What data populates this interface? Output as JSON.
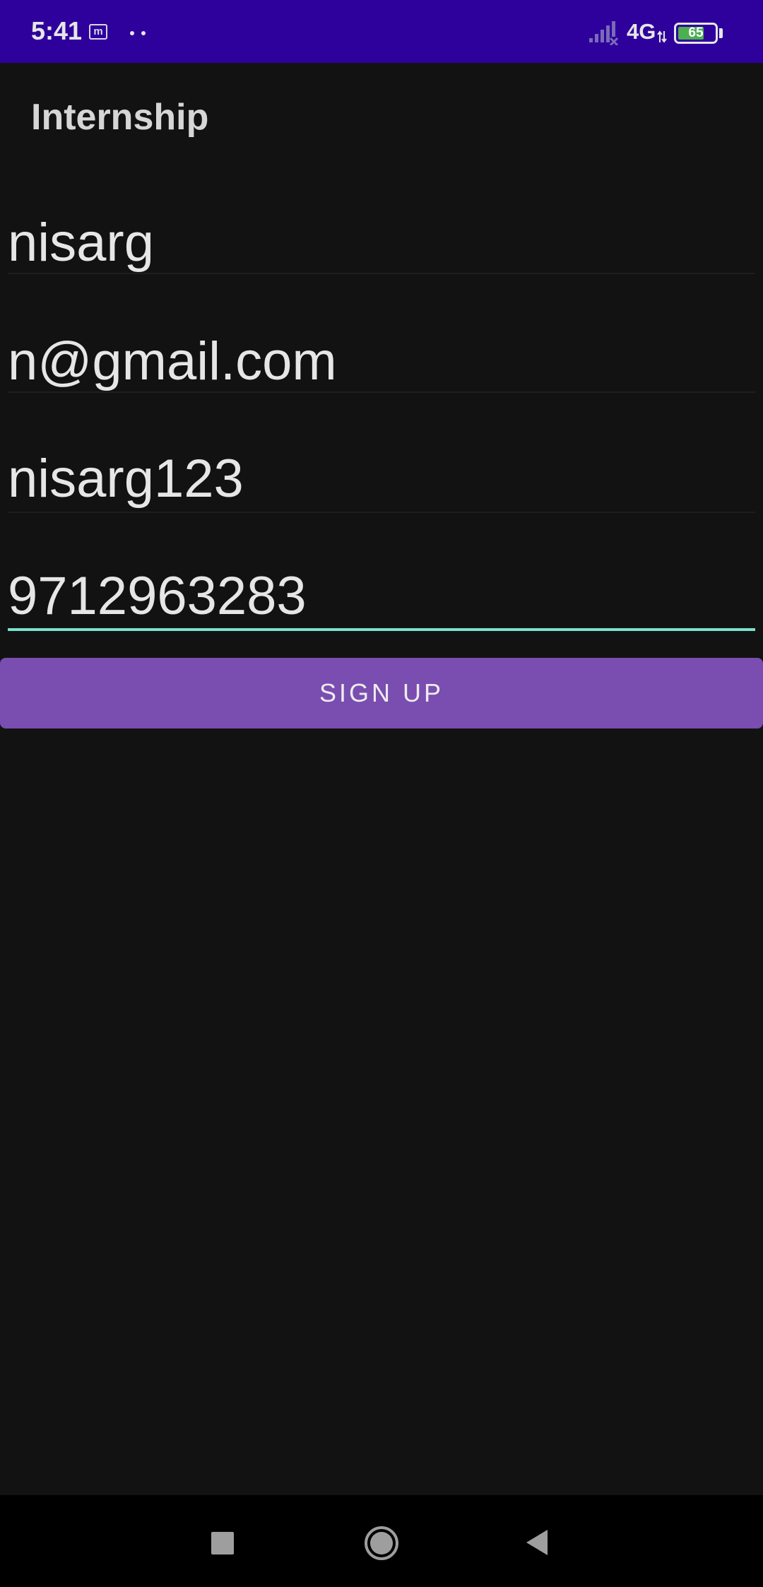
{
  "status_bar": {
    "time": "5:41",
    "notification_icon": "m",
    "network": "4G",
    "battery_level": "65",
    "battery_color": "#4caf50",
    "background": "#2e009c"
  },
  "app_bar": {
    "title": "Internship"
  },
  "form": {
    "name_value": "nisarg",
    "email_value": "n@gmail.com",
    "password_value": "nisarg123",
    "phone_value": "9712963283",
    "focus_color": "#7de0d0"
  },
  "actions": {
    "signup_label": "SIGN UP",
    "button_color": "#7a4db1"
  },
  "nav_bar": {
    "icons": [
      "recents-icon",
      "home-icon",
      "back-icon"
    ]
  }
}
